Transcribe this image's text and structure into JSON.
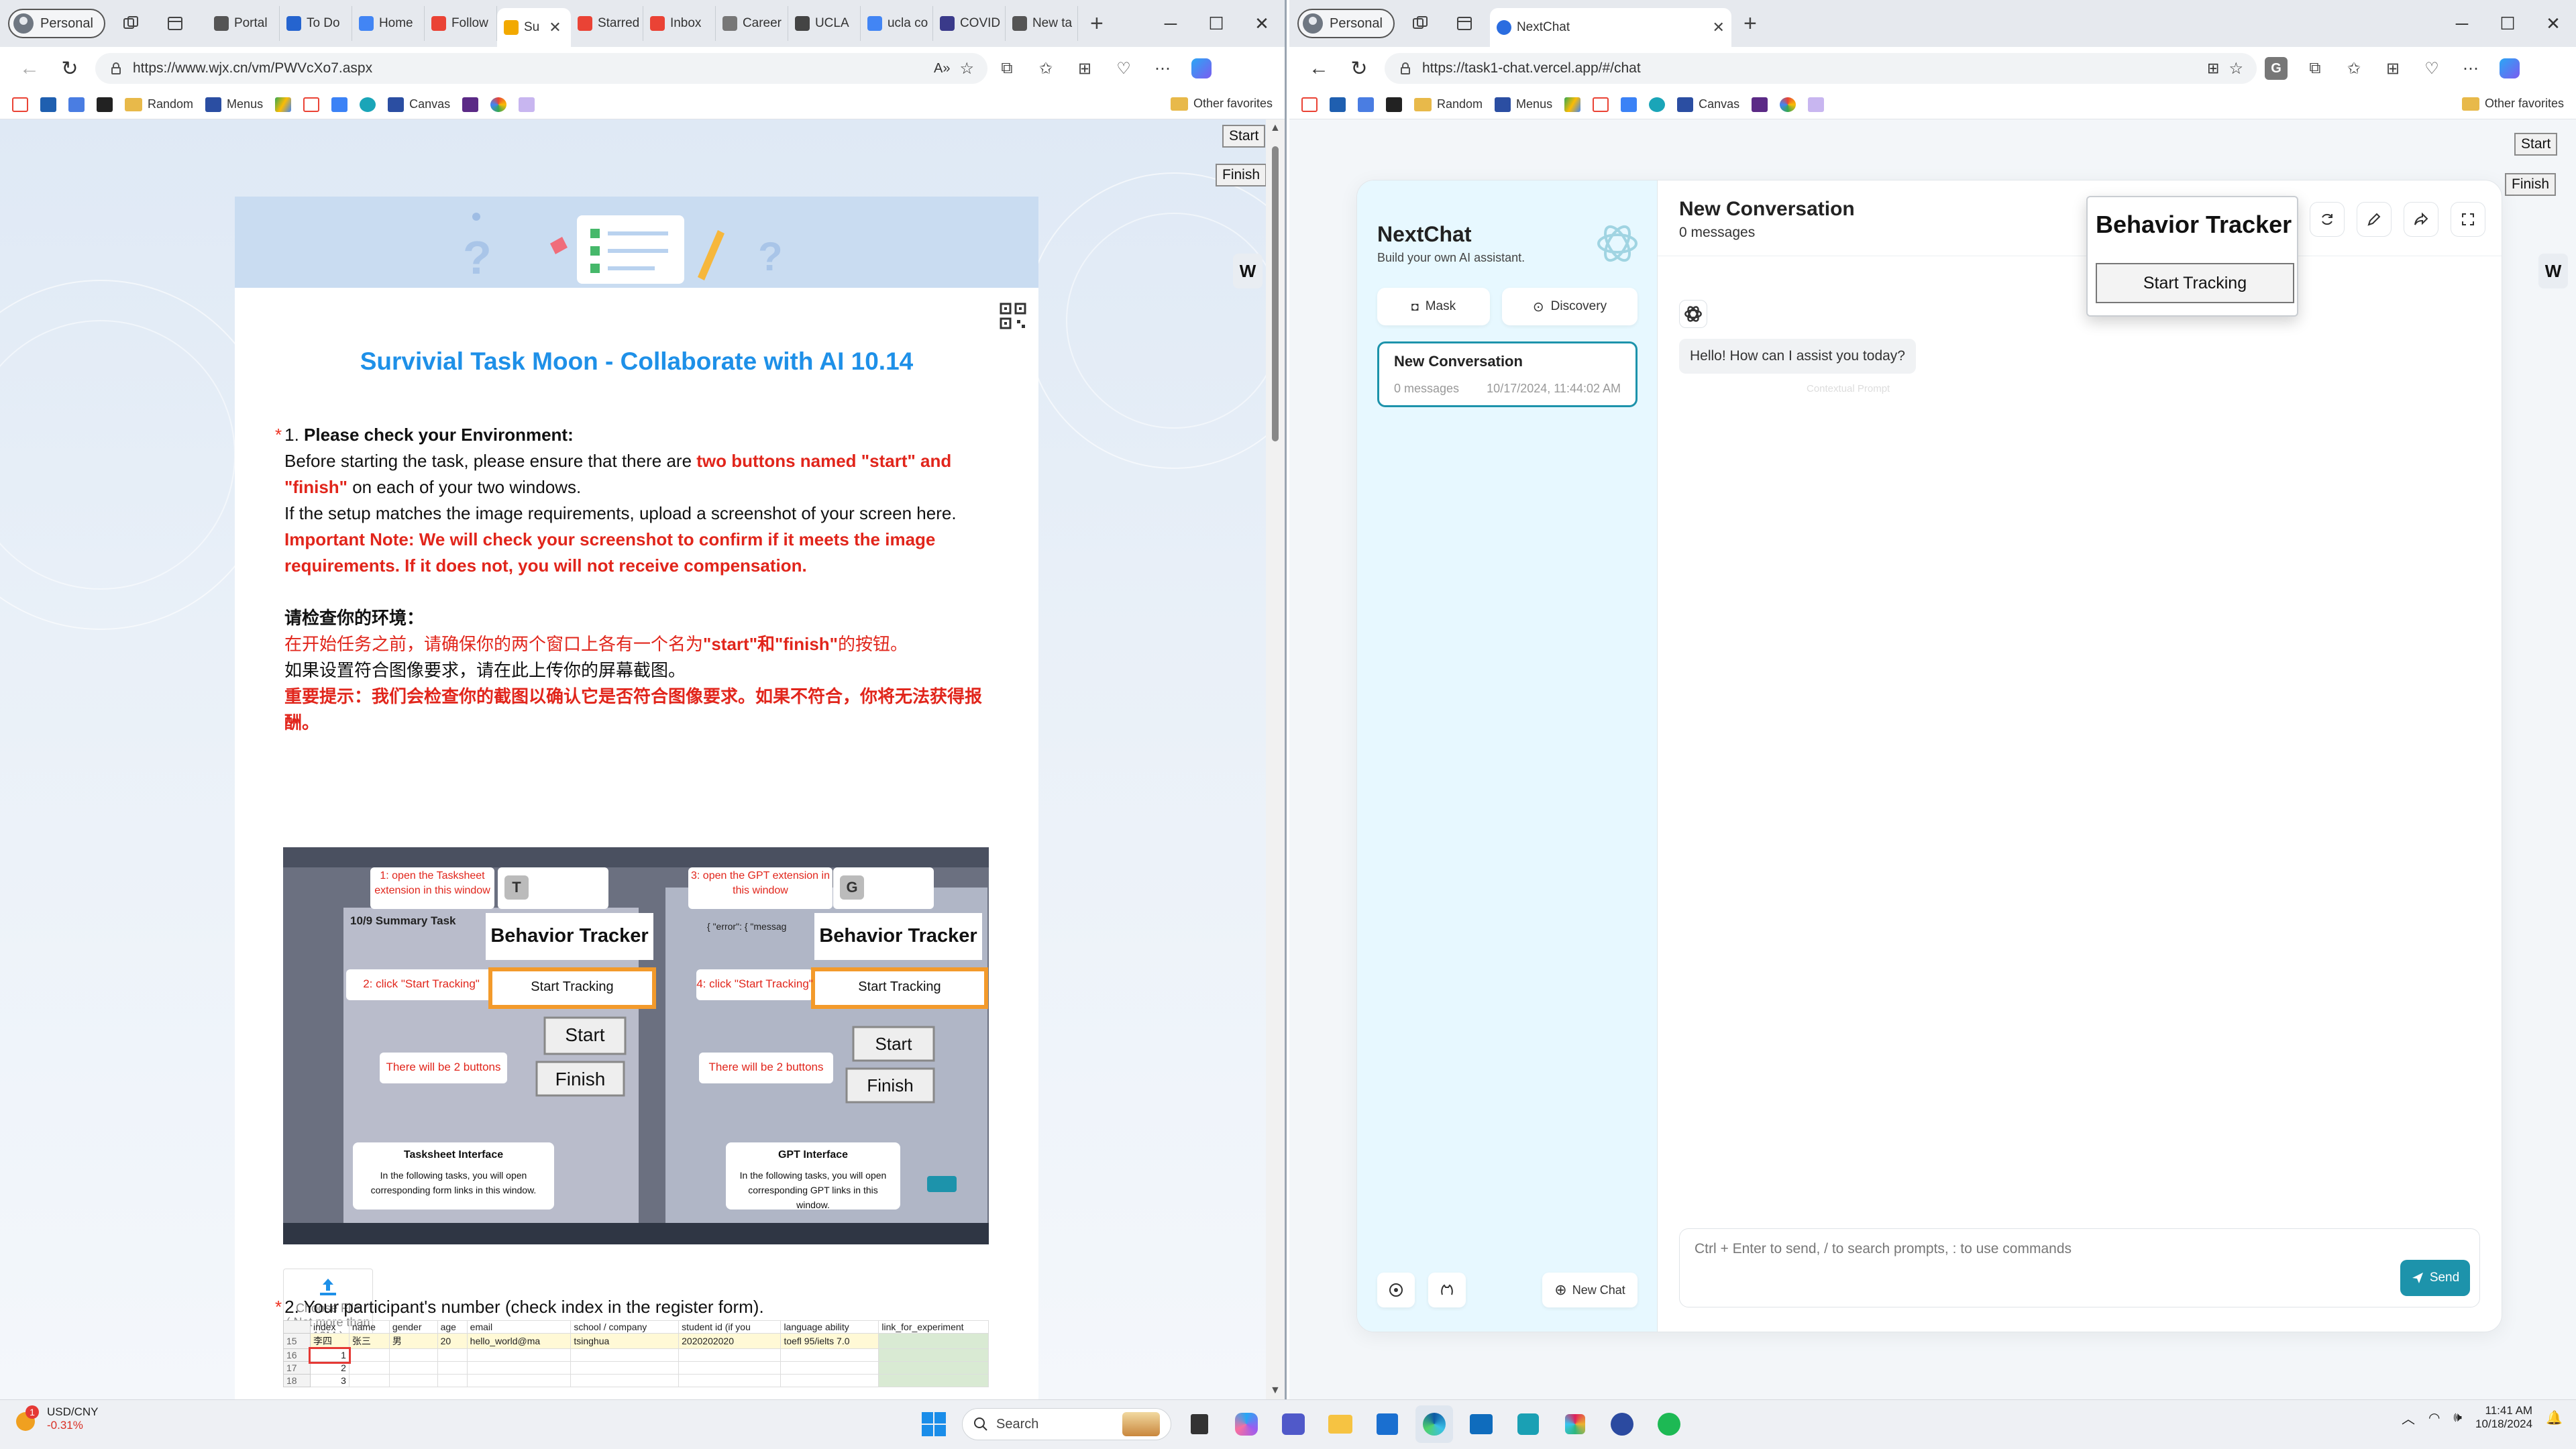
{
  "left_window": {
    "profile": "Personal",
    "tabs": [
      {
        "label": "Portal",
        "color": "#555555"
      },
      {
        "label": "To Do",
        "color": "#2564cf"
      },
      {
        "label": "Home",
        "color": "#4285f4"
      },
      {
        "label": "Follow",
        "color": "#ea4335"
      },
      {
        "label": "Su",
        "color": "#f2a900",
        "active": true
      },
      {
        "label": "Starred",
        "color": "#ea4335"
      },
      {
        "label": "Inbox",
        "color": "#ea4335"
      },
      {
        "label": "Career",
        "color": "#777777"
      },
      {
        "label": "UCLA",
        "color": "#444444"
      },
      {
        "label": "ucla co",
        "color": "#4285f4"
      },
      {
        "label": "COVID",
        "color": "#3a3a8a"
      },
      {
        "label": "New ta",
        "color": "#555555"
      }
    ],
    "url": "https://www.wjx.cn/vm/PWVcXo7.aspx",
    "favorites": [
      "Random",
      "Menus",
      "Canvas"
    ],
    "other_favorites": "Other favorites",
    "start_label": "Start",
    "finish_label": "Finish",
    "w_label": "W",
    "survey": {
      "title": "Survivial Task Moon - Collaborate with AI 10.14",
      "q1_number": "1.",
      "q1_heading": "Please check your Environment:",
      "q1_line1_a": "Before starting the task, please ensure that there are ",
      "q1_line1_b": "two buttons named \"start\" and",
      "q1_line2_a": "\"finish\"",
      "q1_line2_b": " on each of your two windows.",
      "q1_line3": "If the setup matches the image requirements, upload a screenshot of your screen here.",
      "q1_line4": "Important Note: We will check your screenshot to confirm if it meets the image",
      "q1_line5": "requirements. If it does not, you will not receive compensation.",
      "zh_heading": "请检查你的环境：",
      "zh_line1_a": "在开始任务之前，请确保你的两个窗口上各有一个名为",
      "zh_line1_b": "\"start\"和\"finish\"",
      "zh_line1_c": "的按钮。",
      "zh_line2": "如果设置符合图像要求，请在此上传你的屏幕截图。",
      "zh_line3": "重要提示：我们会检查你的截图以确认它是否符合图像要求。如果不符合，你将无法获得报",
      "zh_line4": "酬。",
      "screenshot": {
        "step1": "1: open the Tasksheet extension in this window",
        "step2": "2: click \"Start Tracking\"",
        "step3": "3: open the GPT extension in this window",
        "step4": "4: click \"Start Tracking\"",
        "two_buttons": "There will be 2 buttons",
        "bt_title": "Behavior Tracker",
        "bt_button": "Start Tracking",
        "start": "Start",
        "finish": "Finish",
        "t_key": "T",
        "g_key": "G",
        "tasksheet_title": "Tasksheet Interface",
        "tasksheet_desc": "In the following tasks, you will open corresponding form links in this window.",
        "gpt_title": "GPT Interface",
        "gpt_desc": "In the following tasks, you will open corresponding GPT links in this window.",
        "summary": "10/9 Summary Task",
        "error_text": "{ \"error\": { \"messag"
      },
      "upload_label": "Choose File",
      "upload_limit": "( Not more than 10M )",
      "q2_number": "2.",
      "q2_text": "Your participant's number (check index in the register form).",
      "sheet_headers": [
        "index",
        "name",
        "gender",
        "age",
        "email",
        "school / company",
        "student id (if you",
        "language ability",
        "link_for_experiment"
      ],
      "sheet_rows": [
        {
          "row": "15",
          "cells": [
            "李四",
            "张三",
            "男",
            "20",
            "hello_world@ma",
            "tsinghua",
            "2020202020",
            "toefl 95/ielts 7.0",
            ""
          ]
        },
        {
          "row": "16",
          "cells": [
            "1",
            "",
            "",
            "",
            "",
            "",
            "",
            "",
            ""
          ]
        },
        {
          "row": "17",
          "cells": [
            "2",
            "",
            "",
            "",
            "",
            "",
            "",
            "",
            ""
          ]
        },
        {
          "row": "18",
          "cells": [
            "3",
            "",
            "",
            "",
            "",
            "",
            "",
            "",
            ""
          ]
        }
      ]
    }
  },
  "right_window": {
    "profile": "Personal",
    "tab_label": "NextChat",
    "url": "https://task1-chat.vercel.app/#/chat",
    "favorites": [
      "Random",
      "Menus",
      "Canvas"
    ],
    "other_favorites": "Other favorites",
    "start_label": "Start",
    "finish_label": "Finish",
    "w_label": "W",
    "ext_key": "G",
    "popup": {
      "title": "Behavior Tracker",
      "button": "Start Tracking"
    },
    "app": {
      "name": "NextChat",
      "tagline": "Build your own AI assistant.",
      "mask": "Mask",
      "discovery": "Discovery",
      "conversation": {
        "title": "New Conversation",
        "count": "0 messages",
        "date": "10/17/2024, 11:44:02 AM"
      },
      "new_chat": "New Chat",
      "header_title": "New Conversation",
      "header_sub": "0 messages",
      "greeting": "Hello! How can I assist you today?",
      "context_prompt": "Contextual Prompt",
      "input_placeholder": "Ctrl + Enter to send, / to search prompts, : to use commands",
      "send": "Send",
      "accent": "#1d93ab"
    }
  },
  "taskbar": {
    "ticker_name": "USD/CNY",
    "ticker_change": "-0.31%",
    "badge": "1",
    "search_label": "Search",
    "time": "11:41 AM",
    "date": "10/18/2024"
  }
}
